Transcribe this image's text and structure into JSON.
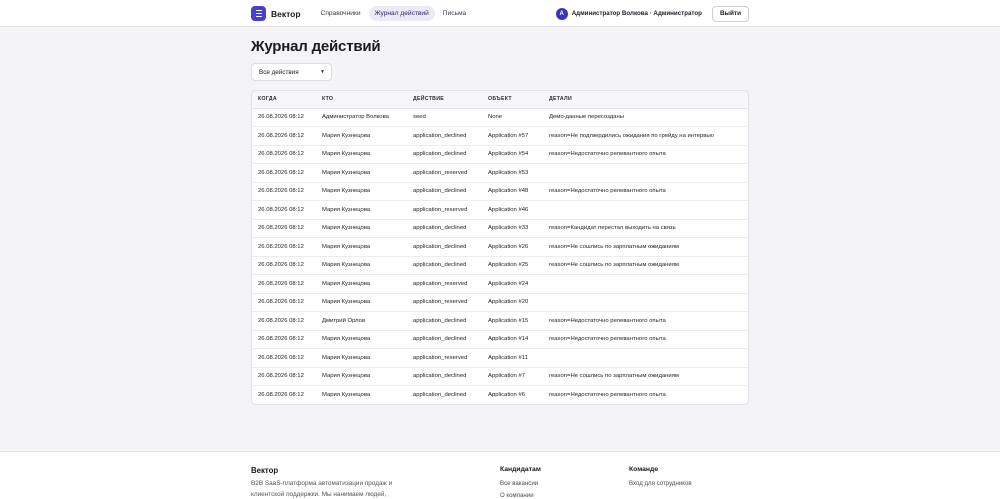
{
  "header": {
    "brand": "Вектор",
    "nav": [
      {
        "label": "Справочники",
        "active": false
      },
      {
        "label": "Журнал действий",
        "active": true
      },
      {
        "label": "Письма",
        "active": false
      }
    ],
    "user_initial": "А",
    "user_label": "Администратор Волкова · Администратор",
    "logout_label": "Выйти"
  },
  "main": {
    "title": "Журнал действий",
    "filter_value": "Все действия"
  },
  "table": {
    "columns": [
      "Когда",
      "Кто",
      "Действие",
      "Объект",
      "Детали"
    ],
    "rows": [
      [
        "26.08.2026 08:12",
        "Администратор Волкова",
        "seed",
        "None",
        "Демо-данные пересозданы"
      ],
      [
        "26.08.2026 08:12",
        "Мария Кузнецова",
        "application_declined",
        "Application #57",
        "reason=Не подтвердились ожидания по грейду на интервью"
      ],
      [
        "26.08.2026 08:12",
        "Мария Кузнецова",
        "application_declined",
        "Application #54",
        "reason=Недостаточно релевантного опыта"
      ],
      [
        "26.08.2026 08:12",
        "Мария Кузнецова",
        "application_reserved",
        "Application #53",
        ""
      ],
      [
        "26.08.2026 08:12",
        "Мария Кузнецова",
        "application_declined",
        "Application #48",
        "reason=Недостаточно релевантного опыта"
      ],
      [
        "26.08.2026 08:12",
        "Мария Кузнецова",
        "application_reserved",
        "Application #46",
        ""
      ],
      [
        "26.08.2026 08:12",
        "Мария Кузнецова",
        "application_declined",
        "Application #33",
        "reason=Кандидат перестал выходить на связь"
      ],
      [
        "26.08.2026 08:12",
        "Мария Кузнецова",
        "application_declined",
        "Application #26",
        "reason=Не сошлись по зарплатным ожиданиям"
      ],
      [
        "26.08.2026 08:12",
        "Мария Кузнецова",
        "application_declined",
        "Application #25",
        "reason=Не сошлись по зарплатным ожиданиям"
      ],
      [
        "26.08.2026 08:12",
        "Мария Кузнецова",
        "application_reserved",
        "Application #24",
        ""
      ],
      [
        "26.08.2026 08:12",
        "Мария Кузнецова",
        "application_reserved",
        "Application #20",
        ""
      ],
      [
        "26.08.2026 08:12",
        "Дмитрий Орлов",
        "application_declined",
        "Application #15",
        "reason=Недостаточно релевантного опыта"
      ],
      [
        "26.08.2026 08:12",
        "Мария Кузнецова",
        "application_declined",
        "Application #14",
        "reason=Недостаточно релевантного опыта"
      ],
      [
        "26.08.2026 08:12",
        "Мария Кузнецова",
        "application_reserved",
        "Application #11",
        ""
      ],
      [
        "26.08.2026 08:12",
        "Мария Кузнецова",
        "application_declined",
        "Application #7",
        "reason=Не сошлись по зарплатным ожиданиям"
      ],
      [
        "26.08.2026 08:12",
        "Мария Кузнецова",
        "application_declined",
        "Application #6",
        "reason=Недостаточно релевантного опыта"
      ]
    ]
  },
  "footer": {
    "brand": "Вектор",
    "description": "B2B SaaS-платформа автоматизации продаж и клиентской поддержки. Мы нанимаем людей,",
    "candidates_title": "Кандидатам",
    "candidates_links": [
      "Все вакансии",
      "О компании"
    ],
    "team_title": "Команде",
    "team_links": [
      "Вход для сотрудников"
    ]
  },
  "colors": {
    "accent": "#4a3fc9",
    "avatar": "#3d35b8",
    "active_nav_bg": "#ebeaf5",
    "page_bg": "#f4f4f6"
  }
}
